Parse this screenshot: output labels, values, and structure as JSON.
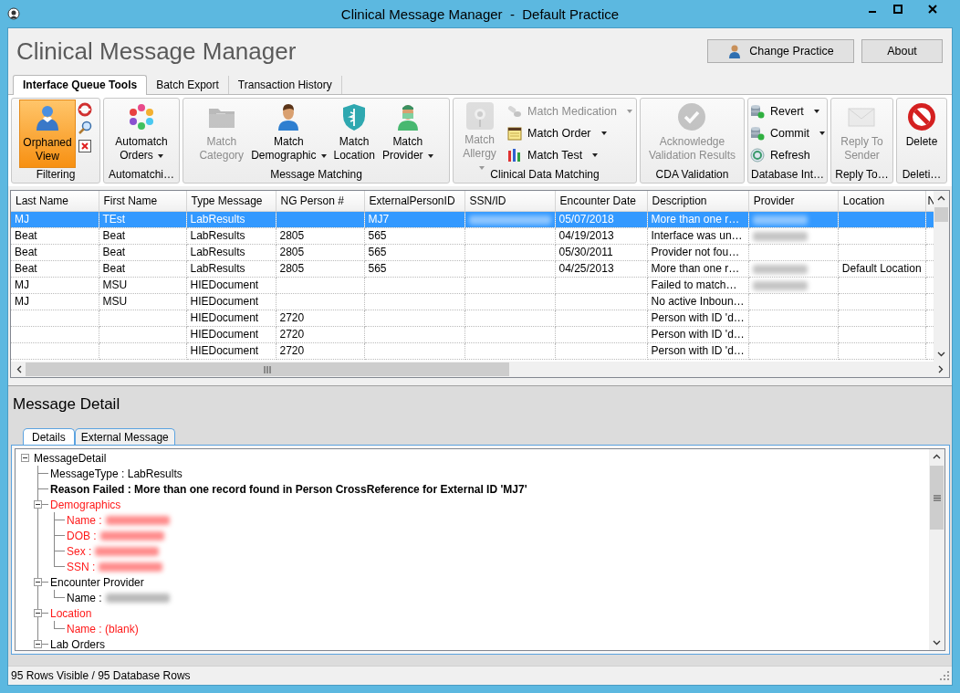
{
  "window": {
    "title": "Clinical Message Manager  -  Default Practice"
  },
  "header": {
    "title": "Clinical Message Manager",
    "buttons": [
      {
        "label": "Change Practice",
        "kind": "practice"
      },
      {
        "label": "About",
        "kind": "plain"
      }
    ]
  },
  "ribbon": {
    "tabs": [
      {
        "label": "Interface Queue Tools",
        "selected": true
      },
      {
        "label": "Batch Export",
        "selected": false
      },
      {
        "label": "Transaction History",
        "selected": false
      }
    ],
    "groups": [
      {
        "label": "Filtering",
        "buttons": [
          {
            "kind": "large",
            "label": "Orphaned\nView",
            "selected": true,
            "disabled": false,
            "dropdown": false
          },
          {
            "kind": "icon"
          },
          {
            "kind": "icon"
          },
          {
            "kind": "icon"
          }
        ]
      },
      {
        "label": "Automatchi…",
        "buttons": [
          {
            "kind": "large",
            "label": "Automatch\nOrders",
            "selected": false,
            "disabled": false,
            "dropdown": true
          }
        ]
      },
      {
        "label": "Message Matching",
        "buttons": [
          {
            "kind": "large",
            "label": "Match\nCategory",
            "selected": false,
            "disabled": true,
            "dropdown": false
          },
          {
            "kind": "large",
            "label": "Match\nDemographic",
            "selected": false,
            "disabled": false,
            "dropdown": true
          },
          {
            "kind": "large",
            "label": "Match\nLocation",
            "selected": false,
            "disabled": false,
            "dropdown": false
          },
          {
            "kind": "large",
            "label": "Match\nProvider",
            "selected": false,
            "disabled": false,
            "dropdown": true
          }
        ]
      },
      {
        "label": "Clinical Data Matching",
        "buttons": [
          {
            "kind": "large",
            "label": "Match\nAllergy",
            "selected": false,
            "disabled": true,
            "dropdown": true
          },
          {
            "kind": "small",
            "label": "Match Medication",
            "selected": false,
            "disabled": true,
            "dropdown": true
          },
          {
            "kind": "small",
            "label": "Match Order",
            "selected": false,
            "disabled": false,
            "dropdown": true
          },
          {
            "kind": "small",
            "label": "Match Test",
            "selected": false,
            "disabled": false,
            "dropdown": true
          }
        ]
      },
      {
        "label": "CDA Validation",
        "buttons": [
          {
            "kind": "large",
            "label": "Acknowledge\nValidation Results",
            "selected": false,
            "disabled": true,
            "dropdown": false
          }
        ]
      },
      {
        "label": "Database  Int…",
        "buttons": [
          {
            "kind": "small",
            "label": "Revert",
            "selected": false,
            "disabled": false,
            "dropdown": true
          },
          {
            "kind": "small",
            "label": "Commit",
            "selected": false,
            "disabled": false,
            "dropdown": true
          },
          {
            "kind": "small",
            "label": "Refresh",
            "selected": false,
            "disabled": false,
            "dropdown": false
          }
        ]
      },
      {
        "label": "Reply To…",
        "buttons": [
          {
            "kind": "large",
            "label": "Reply To\nSender",
            "selected": false,
            "disabled": true,
            "dropdown": false
          }
        ]
      },
      {
        "label": "Deleti…",
        "buttons": [
          {
            "kind": "large",
            "label": "Delete",
            "selected": false,
            "disabled": false,
            "dropdown": false
          }
        ]
      }
    ]
  },
  "grid": {
    "columns": [
      "Last Name",
      "First Name",
      "Type Message",
      "NG Person #",
      "ExternalPersonID",
      "SSN/ID",
      "Encounter Date",
      "Description",
      "Provider",
      "Location",
      "N"
    ],
    "rows": [
      {
        "selected": true,
        "cells": [
          "MJ",
          "TEst",
          "LabResults",
          null,
          "MJ7",
          {
            "blurred": true
          },
          "05/07/2018",
          "More than one r…",
          {
            "blurred": true
          },
          null,
          null
        ]
      },
      {
        "selected": false,
        "cells": [
          "Beat",
          "Beat",
          "LabResults",
          "2805",
          "565",
          null,
          "04/19/2013",
          "Interface was un…",
          {
            "blurred": true
          },
          null,
          null
        ]
      },
      {
        "selected": false,
        "cells": [
          "Beat",
          "Beat",
          "LabResults",
          "2805",
          "565",
          null,
          "05/30/2011",
          "Provider not fou…",
          null,
          null,
          null
        ]
      },
      {
        "selected": false,
        "cells": [
          "Beat",
          "Beat",
          "LabResults",
          "2805",
          "565",
          null,
          "04/25/2013",
          "More than one r…",
          {
            "blurred": true
          },
          "Default Location",
          null
        ]
      },
      {
        "selected": false,
        "cells": [
          "MJ",
          "MSU",
          "HIEDocument",
          null,
          null,
          null,
          null,
          "Failed to match…",
          {
            "blurred": true
          },
          null,
          null
        ]
      },
      {
        "selected": false,
        "cells": [
          "MJ",
          "MSU",
          "HIEDocument",
          null,
          null,
          null,
          null,
          "No active Inboun…",
          null,
          null,
          null
        ]
      },
      {
        "selected": false,
        "cells": [
          null,
          null,
          "HIEDocument",
          "2720",
          null,
          null,
          null,
          "Person with ID 'd…",
          null,
          null,
          null
        ]
      },
      {
        "selected": false,
        "cells": [
          null,
          null,
          "HIEDocument",
          "2720",
          null,
          null,
          null,
          "Person with ID 'd…",
          null,
          null,
          null
        ]
      },
      {
        "selected": false,
        "cells": [
          null,
          null,
          "HIEDocument",
          "2720",
          null,
          null,
          null,
          "Person with ID 'd…",
          null,
          null,
          null
        ]
      }
    ]
  },
  "detail": {
    "title": "Message Detail",
    "tabs": [
      {
        "label": "Details",
        "selected": true
      },
      {
        "label": "External Message",
        "selected": false
      }
    ],
    "tree": [
      {
        "label": "MessageDetail",
        "flagged": false,
        "bold": false,
        "expanded": true,
        "children": [
          {
            "label": "MessageType : LabResults",
            "flagged": false,
            "bold": false
          },
          {
            "label": "Reason Failed : More than one record found in Person CrossReference for External ID 'MJ7'",
            "flagged": false,
            "bold": true
          },
          {
            "label": "Demographics",
            "flagged": true,
            "bold": false,
            "expanded": true,
            "children": [
              {
                "label": "Name :",
                "flagged": true,
                "bold": false,
                "blurred_value": true
              },
              {
                "label": "DOB :",
                "flagged": true,
                "bold": false,
                "blurred_value": true
              },
              {
                "label": "Sex :",
                "flagged": true,
                "bold": false,
                "blurred_value": true
              },
              {
                "label": "SSN :",
                "flagged": true,
                "bold": false,
                "blurred_value": true
              }
            ]
          },
          {
            "label": "Encounter Provider",
            "flagged": false,
            "bold": false,
            "expanded": true,
            "children": [
              {
                "label": "Name :",
                "flagged": false,
                "bold": false,
                "blurred_value": true
              }
            ]
          },
          {
            "label": "Location",
            "flagged": true,
            "bold": false,
            "expanded": true,
            "children": [
              {
                "label": "Name : (blank)",
                "flagged": true,
                "bold": false
              }
            ]
          },
          {
            "label": "Lab Orders",
            "flagged": false,
            "bold": false,
            "expanded": true
          }
        ]
      }
    ]
  },
  "status_bar": {
    "text": "95 Rows Visible / 95 Database Rows"
  }
}
